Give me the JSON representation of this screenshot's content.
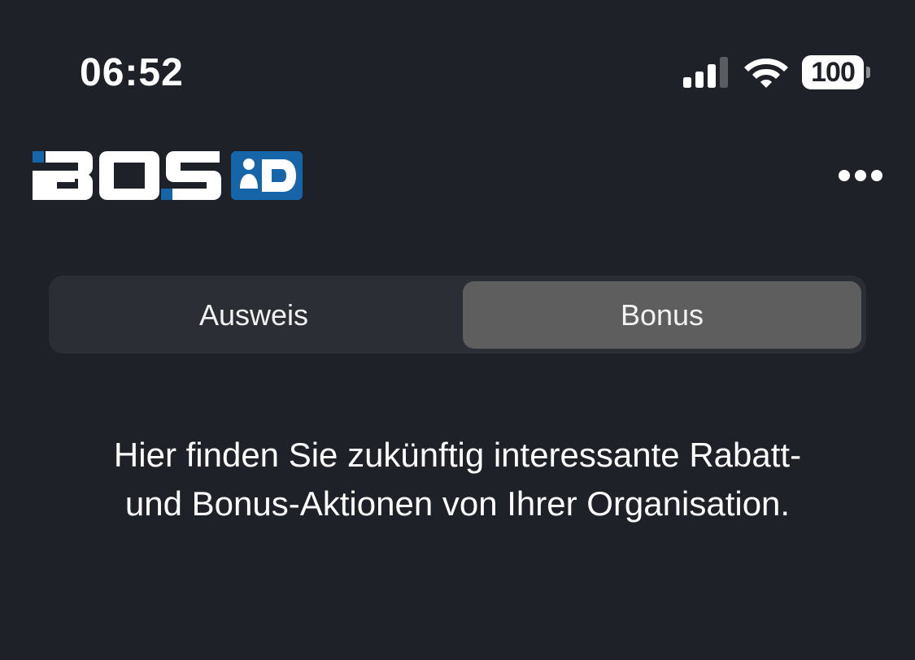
{
  "status_bar": {
    "time": "06:52",
    "battery_level": "100",
    "icons": [
      "cellular-signal-icon",
      "wifi-icon",
      "battery-icon"
    ]
  },
  "header": {
    "logo_text": "BOS iD",
    "menu_icon": "more-horizontal-icon"
  },
  "tabs": [
    {
      "label": "Ausweis",
      "selected": false
    },
    {
      "label": "Bonus",
      "selected": true
    }
  ],
  "bonus": {
    "message": "Hier finden Sie zukünftig interessante Rabatt- und Bonus-Aktionen von Ihrer Organisation."
  },
  "colors": {
    "background": "#1f2128",
    "segmented_track": "#2c2e35",
    "segment_selected": "#5e5e5f",
    "logo_blue": "#1565a8",
    "text": "#ffffff"
  }
}
